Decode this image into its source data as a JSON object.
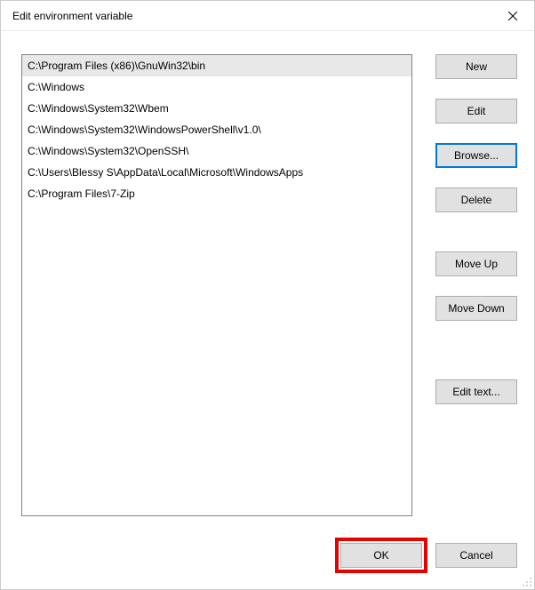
{
  "title": "Edit environment variable",
  "list": {
    "selectedIndex": 0,
    "items": [
      "C:\\Program Files (x86)\\GnuWin32\\bin",
      "C:\\Windows",
      "C:\\Windows\\System32\\Wbem",
      "C:\\Windows\\System32\\WindowsPowerShell\\v1.0\\",
      "C:\\Windows\\System32\\OpenSSH\\",
      "C:\\Users\\Blessy S\\AppData\\Local\\Microsoft\\WindowsApps",
      "C:\\Program Files\\7-Zip"
    ]
  },
  "buttons": {
    "new": "New",
    "edit": "Edit",
    "browse": "Browse...",
    "delete": "Delete",
    "moveUp": "Move Up",
    "moveDown": "Move Down",
    "editText": "Edit text...",
    "ok": "OK",
    "cancel": "Cancel"
  }
}
